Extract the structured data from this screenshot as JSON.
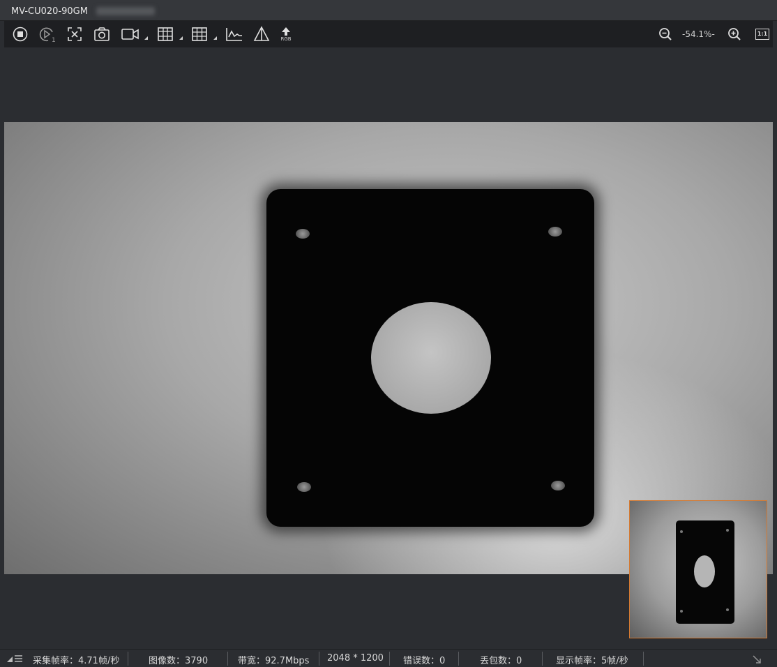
{
  "window": {
    "title": "MV-CU020-90GM"
  },
  "toolbar": {
    "icons": [
      "stop-icon",
      "play-once-icon",
      "fit-screen-icon",
      "camera-icon",
      "record-icon",
      "grid-cross-icon",
      "grid-icon",
      "histogram-icon",
      "mirror-icon",
      "rgb-icon"
    ],
    "rgb_label": "RGB",
    "zoom_value": "-54.1%-",
    "zoom_out": "zoom-out-icon",
    "zoom_in": "zoom-in-icon",
    "actual_size_label": "1:1"
  },
  "status": {
    "capture_fps": "采集帧率：4.71帧/秒",
    "image_count": "图像数：3790",
    "bandwidth": "带宽：92.7Mbps",
    "resolution": "2048 * 1200",
    "error_count": "错误数：0",
    "lost_packets": "丢包数：0",
    "display_fps": "显示帧率：5帧/秒"
  },
  "colors": {
    "minimap_border": "#d47a32",
    "toolbar_bg": "#1e1f22"
  }
}
